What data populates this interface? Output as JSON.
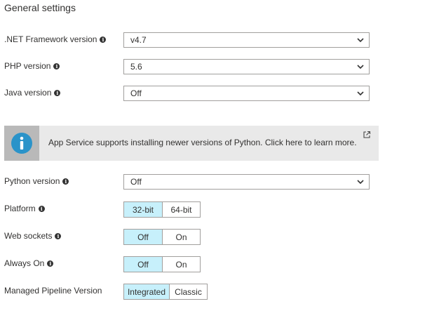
{
  "heading": "General settings",
  "net_framework": {
    "label": ".NET Framework version",
    "value": "v4.7"
  },
  "php": {
    "label": "PHP version",
    "value": "5.6"
  },
  "java": {
    "label": "Java version",
    "value": "Off"
  },
  "banner": {
    "text": "App Service supports installing newer versions of Python. Click here to learn more."
  },
  "python": {
    "label": "Python version",
    "value": "Off"
  },
  "platform": {
    "label": "Platform",
    "options": [
      "32-bit",
      "64-bit"
    ],
    "selected": "32-bit"
  },
  "web_sockets": {
    "label": "Web sockets",
    "options": [
      "Off",
      "On"
    ],
    "selected": "Off"
  },
  "always_on": {
    "label": "Always On",
    "options": [
      "Off",
      "On"
    ],
    "selected": "Off"
  },
  "pipeline": {
    "label": "Managed Pipeline Version",
    "options": [
      "Integrated",
      "Classic"
    ],
    "selected": "Integrated"
  },
  "colors": {
    "selected_segment": "#c7f0fb",
    "banner_bg": "#e9e9e9",
    "banner_icon_bg": "#b9b9b9",
    "info_icon_blue": "#2a93c9"
  },
  "icons": {
    "info": "info-circle-icon",
    "chevron": "chevron-down-icon",
    "external": "external-link-icon"
  }
}
